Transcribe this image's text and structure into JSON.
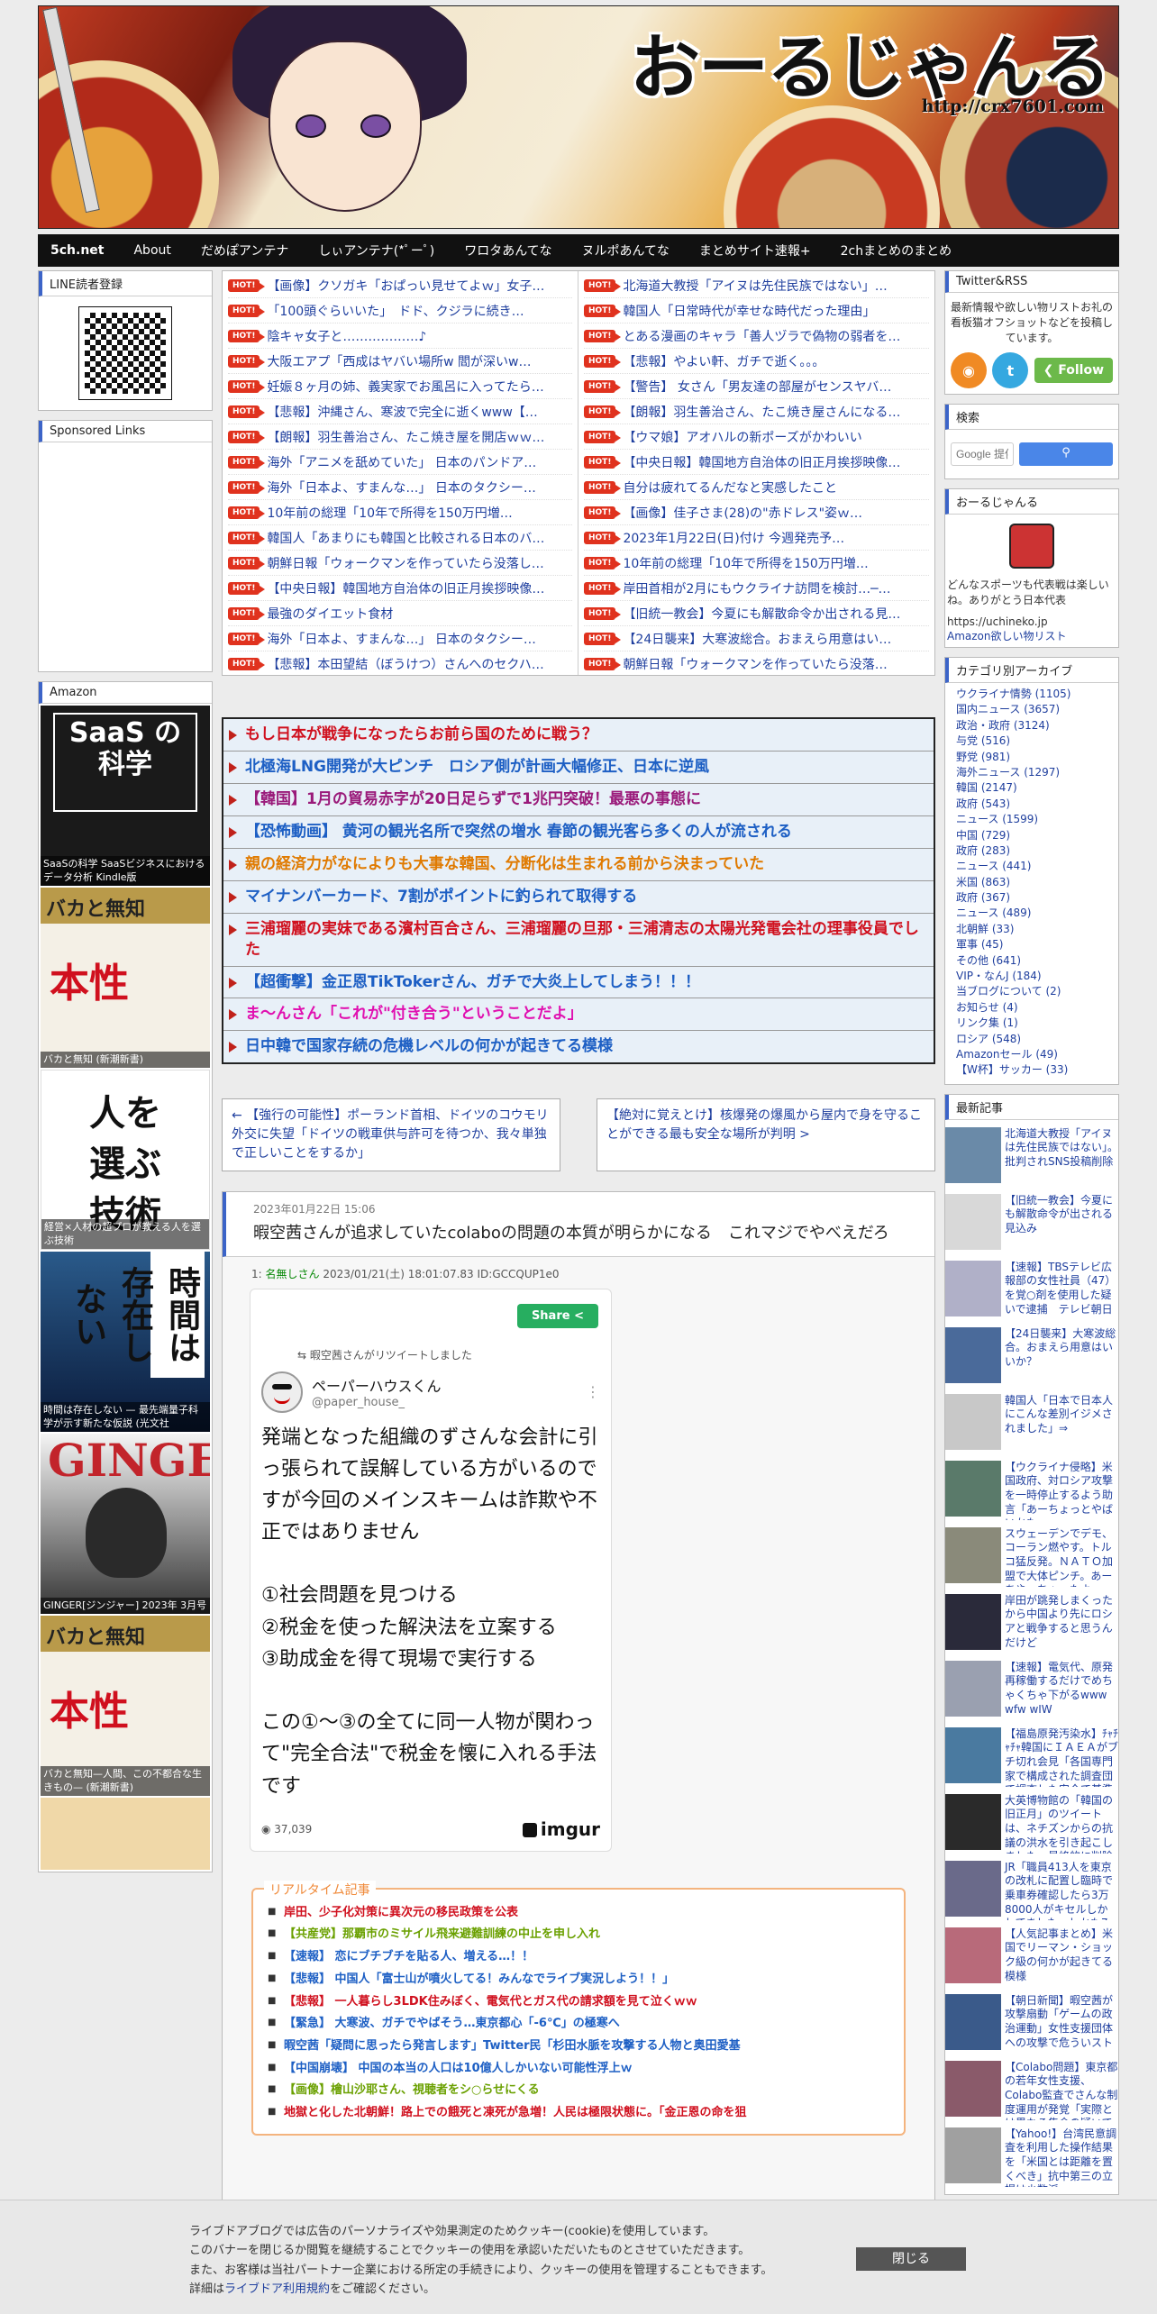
{
  "site": {
    "title": "おーるじゃんる",
    "url": "http://crx7601.com"
  },
  "nav": [
    "5ch.net",
    "About",
    "だめぽアンテナ",
    "しぃアンテナ(*ﾟーﾟ)",
    "ワロタあんてな",
    "ヌルポあんてな",
    "まとめサイト速報+",
    "2chまとめのまとめ"
  ],
  "left": {
    "line_title": "LINE読者登録",
    "sponsored_title": "Sponsored Links",
    "amazon_title": "Amazon",
    "books": [
      {
        "cover": "SaaS の 科学",
        "caption": "SaaSの科学 SaaSビジネスにおけるデータ分析  Kindle版"
      },
      {
        "cover": "バカと無知",
        "caption": "バカと無知 (新潮新書)"
      },
      {
        "cover": "人を 選ぶ 技術",
        "caption": "経営×人材の超プロが教える人を選ぶ技術"
      },
      {
        "cover": "時間は存在しない",
        "caption": "時間は存在しない  — 最先端量子科学が示す新たな仮説 (光文社"
      },
      {
        "cover": "GINGER",
        "caption": "GINGER[ジンジャー] 2023年 3月号"
      },
      {
        "cover": "バカと無知",
        "caption": "バカと無知—人間、この不都合な生きもの— (新潮新書)"
      },
      {
        "cover": "",
        "caption": ""
      }
    ]
  },
  "ranking": {
    "hot_label": "HOT!",
    "left": [
      "【画像】クソガキ「おぱっい見せてよｗ」女子…",
      "「100頭ぐらいいた」　ドド、クジラに続き…",
      "陰キャ女子と………………♪",
      "大阪エアプ「西成はヤバい場所w 閻が深いw…",
      "妊娠８ヶ月の姉、義実家でお風呂に入ってたら…",
      "【悲報】沖縄さん、寒波で完全に逝くwww【…",
      "【朗報】羽生善治さん、たこ焼き屋を開店ｗｗ…",
      "海外「アニメを舐めていた」 日本のパンドア…",
      "海外「日本よ、すまんな…」 日本のタクシー…",
      "10年前の総理「10年で所得を150万円増…",
      "韓国人「あまりにも韓国と比較される日本のバ…",
      "朝鮮日報「ウォークマンを作っていたら没落し…",
      "【中央日報】韓国地方自治体の旧正月挨拶映像…",
      "最強のダイエット食材",
      "海外「日本よ、すまんな…」 日本のタクシー…",
      "【悲報】本田望結（ぼうけつ）さんへのセクハ…"
    ],
    "right": [
      "北海道大教授「アイヌは先住民族ではない」…",
      "韓国人「日常時代が幸せな時代だった理由」",
      "とある漫画のキャラ「善人ヅラで偽物の弱者を…",
      "【悲報】やよい軒、ガチで逝く。。。",
      "【警告】 女さん「男友達の部屋がセンスヤバ…",
      "【朗報】羽生善治さん、たこ焼き屋さんになる…",
      "【ウマ娘】アオハルの新ポーズがかわいい",
      "【中央日報】韓国地方自治体の旧正月挨拶映像…",
      "自分は疲れてるんだなと実感したこと",
      "【画像】佳子さま(28)の\"赤ドレス\"姿ｗ…",
      "2023年1月22日(日)付け 今週発売予…",
      "10年前の総理「10年で所得を150万円増…",
      "岸田首相が2月にもウクライナ訪問を検討…─…",
      "【旧統一教会】今夏にも解散命令か出される見…",
      "【24日襲来】大寒波総合。おまえら用意はい…",
      "朝鮮日報「ウォークマンを作っていたら没落…"
    ]
  },
  "pickup": [
    {
      "text": "もし日本が戦争になったらお前ら国のために戦う？",
      "color": "#d0101e"
    },
    {
      "text": "北極海LNG開発が大ピンチ　ロシア側が計画大幅修正、日本に逆風",
      "color": "#1d5fc4"
    },
    {
      "text": "【韓国】1月の貿易赤字が20日足らずで1兆円突破！最悪の事態に",
      "color": "#9a1a7a"
    },
    {
      "text": "【恐怖動画】 黄河の観光名所で突然の増水 春節の観光客ら多くの人が流される",
      "color": "#1d5fc4"
    },
    {
      "text": "親の経済力がなによりも大事な韓国、分断化は生まれる前から決まっていた",
      "color": "#e07a00"
    },
    {
      "text": "マイナンバーカード、7割がポイントに釣られて取得する",
      "color": "#1d5fc4"
    },
    {
      "text": "三浦瑠麗の実妹である濱村百合さん、三浦瑠麗の旦那・三浦清志の太陽光発電会社の理事役員でした",
      "color": "#d0101e"
    },
    {
      "text": "【超衝撃】金正恩TikTokerさん、ガチで大炎上してしまう！！！",
      "color": "#1d5fc4"
    },
    {
      "text": "ま～んさん「これが\"付き合う\"ということだよ」",
      "color": "#e010b0"
    },
    {
      "text": "日中韓で国家存続の危機レベルの何かが起きてる模様",
      "color": "#1d5fc4"
    }
  ],
  "pager": {
    "prev": "← 【強行の可能性】ポーランド首相、ドイツのコウモリ外交に失望「ドイツの戦車供与許可を待つか、我々単独で正しいことをするか」",
    "next": "【絶対に覚えとけ】核爆発の爆風から屋内で身を守ることができる最も安全な場所が判明 >"
  },
  "article": {
    "date": "2023年01月22日 15:06",
    "title": "暇空茜さんが追求していたcolaboの問題の本質が明らかになる　これマジでやべえだろ",
    "res_no": "1:",
    "res_name": "名無しさん",
    "res_meta": "2023/01/21(土) 18:01:07.83 ID:GCCQUP1e0",
    "share": "Share",
    "retweeted": "暇空茜さんがリツイートしました",
    "tw_name": "ペーパーハウスくん",
    "tw_handle": "@paper_house_",
    "tw_text": "発端となった組織のずさんな会計に引っ張られて誤解している方がいるのですが今回のメインスキームは詐欺や不正ではありません\n\n①社会問題を見つける\n②税金を使った解決法を立案する\n③助成金を得て現場で実行する\n\nこの①〜③の全てに同一人物が関わって\"完全合法\"で税金を懐に入れる手法です",
    "tw_views": "37,039",
    "imgur": "imgur"
  },
  "realtime": {
    "label": "リアルタイム記事",
    "items": [
      {
        "text": "岸田、少子化対策に異次元の移民政策を公表",
        "color": "#d0101e"
      },
      {
        "text": "【共産党】那覇市のミサイル飛来避難訓練の中止を申し入れ",
        "color": "#6aa000"
      },
      {
        "text": "【速報】 恋にブチブチを貼る人、増える…！！",
        "color": "#1d5fc4"
      },
      {
        "text": "【悲報】 中国人「富士山が噴火してる！みんなでライブ実況しよう！！」",
        "color": "#1d5fc4"
      },
      {
        "text": "【悲報】 一人暮らし3LDK住みぼく、電気代とガス代の請求額を見て泣くｗｗ",
        "color": "#d0101e"
      },
      {
        "text": "【緊急】 大寒波、ガチでやばそう…東京都心「-6℃」の極寒へ",
        "color": "#1d5fc4"
      },
      {
        "text": "暇空茜「疑問に思ったら発言します」Twitter民「杉田水脈を攻撃する人物と奥田愛基",
        "color": "#1d5fc4"
      },
      {
        "text": "【中国崩壊】 中国の本当の人口は10億人しかいない可能性浮上ｗ",
        "color": "#1d5fc4"
      },
      {
        "text": "【画像】檜山沙耶さん、視聴者をシ○らせにくる",
        "color": "#6aa000"
      },
      {
        "text": "地獄と化した北朝鮮！路上での餓死と凍死が急増！人民は極限状態に。「金正恩の命を狙",
        "color": "#d0101e"
      }
    ]
  },
  "right": {
    "twitter_title": "Twitter&RSS",
    "twitter_desc": "最新情報や欲しい物リストお礼の看板猫オフショットなどを投稿しています。",
    "follow": "Follow",
    "search_title": "検索",
    "search_placeholder": "Google 提供",
    "about_title": "おーるじゃんる",
    "about_desc": "どんなスポーツも代表戦は楽しいね。ありがとう日本代表",
    "about_link1": "https://uchineko.jp",
    "about_link2": "Amazon欲しい物リスト",
    "cat_title": "カテゴリ別アーカイブ",
    "categories": [
      "ウクライナ情勢 (1105)",
      "国内ニュース (3657)",
      "政治・政府 (3124)",
      "与党 (516)",
      "野党 (981)",
      "海外ニュース (1297)",
      "韓国 (2147)",
      "政府 (543)",
      "ニュース (1599)",
      "中国 (729)",
      "政府 (283)",
      "ニュース (441)",
      "米国 (863)",
      "政府 (367)",
      "ニュース (489)",
      "北朝鮮 (33)",
      "軍事 (45)",
      "その他 (641)",
      "VIP・なんJ (184)",
      "当ブログについて (2)",
      "お知らせ (4)",
      "リンク集 (1)",
      "ロシア (548)",
      "Amazonセール (49)",
      "【W杯】サッカー (33)"
    ],
    "recent_title": "最新記事",
    "recent": [
      "北海道大教授「アイヌは先住民族ではない」。批判されSNS投稿削除",
      "【旧統一教会】今夏にも解散命令が出される見込み",
      "【速報】TBSテレビ広報部の女性社員（47）を覚○剤を使用した疑いで逮捕　テレビ朝日",
      "【24日襲来】大寒波総合。おまえら用意はいいか？",
      "韓国人「日本で日本人にこんな差別イジメされました」⇒",
      "【ウクライナ侵略】米国政府、対ロシア攻撃を一時停止するよう助言「あーちょっとやばいかも」",
      "スウェーデンでデモ、コーラン燃やす。トルコ猛反発。ＮＡＴＯ加盟で大体ピンチ。あーあやっちゃったよ",
      "岸田が跳発しまくったから中国より先にロシアと戦争すると思うんだけど",
      "【速報】電気代、原発再稼働するだけでめちゃくちゃ下がるwww wfw wIW",
      "【福島原発汚染水】ﾁｬﾁｬﾁｬ韓国にＩＡＥＡがブチ切れ会見「各国専門家で構成された調査団で調査した安全で基準通りで問題は一切ない」",
      "大英博物館の「韓国の旧正月」のツイートは、ネチズンからの抗議の洪水を引き起こしました…最終的に削除されました",
      "JR「職員413人を東京の改札に配置し臨時で乗車券確認したら3万8000人がキセルしかしてました」しかも7割が○○",
      "【人気記事まとめ】米国でリーマン・ショック級の何かが起きてる模様",
      "【朝日新聞】暇空茜が攻撃扇動「ゲームの政治運動」女性支援団体への攻撃で危ういスト",
      "【Colabo問題】東京都の若年女性支援、Colabo監査でさんな制度運用が発覚「実際とは異なる集金の疑いで購入していない備品」",
      "【Yahoo!】台湾民意調査を利用した操作結果を「米国とは距離を置くべき」抗中第三の立場は少数派"
    ]
  },
  "cookie": {
    "lines": [
      "ライブドアブログでは広告のパーソナライズや効果測定のためクッキー(cookie)を使用しています。",
      "このバナーを閉じるか閲覧を継続することでクッキーの使用を承認いただいたものとさせていただきます。",
      "また、お客様は当社パートナー企業における所定の手続きにより、クッキーの使用を管理することもできます。"
    ],
    "detail_prefix": "詳細は",
    "detail_link": "ライブドア利用規約",
    "detail_suffix": "をご確認ください。",
    "close": "閉じる"
  }
}
